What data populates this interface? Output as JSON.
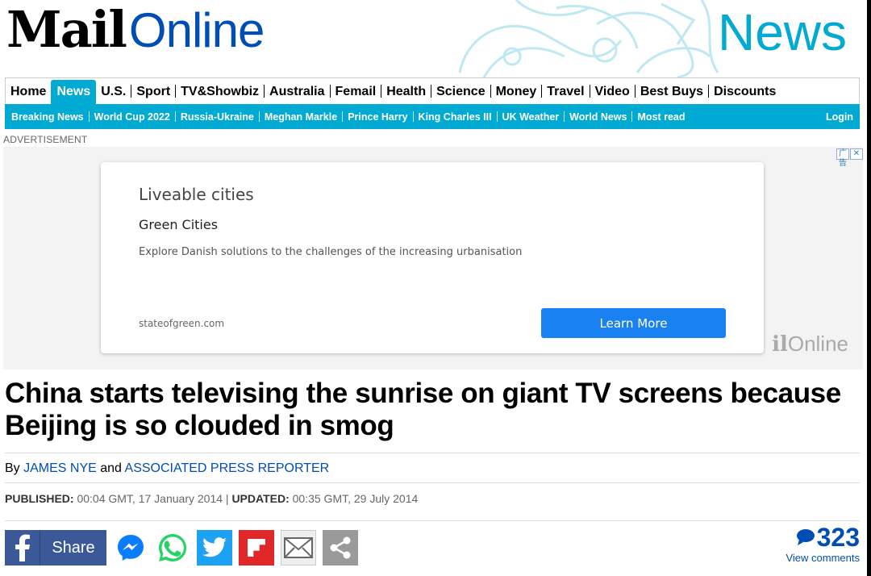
{
  "masthead": {
    "logo_mail": "Mail",
    "logo_online": "Online",
    "section_title": "News"
  },
  "nav_primary": [
    {
      "label": "Home",
      "active": false
    },
    {
      "label": "News",
      "active": true
    },
    {
      "label": "U.S.",
      "active": false
    },
    {
      "label": "Sport",
      "active": false
    },
    {
      "label": "TV&Showbiz",
      "active": false
    },
    {
      "label": "Australia",
      "active": false
    },
    {
      "label": "Femail",
      "active": false
    },
    {
      "label": "Health",
      "active": false
    },
    {
      "label": "Science",
      "active": false
    },
    {
      "label": "Money",
      "active": false
    },
    {
      "label": "Travel",
      "active": false
    },
    {
      "label": "Video",
      "active": false
    },
    {
      "label": "Best Buys",
      "active": false
    },
    {
      "label": "Discounts",
      "active": false
    }
  ],
  "nav_secondary": [
    "Breaking News",
    "World Cup 2022",
    "Russia-Ukraine",
    "Meghan Markle",
    "Prince Harry",
    "King Charles III",
    "UK Weather",
    "World News",
    "Most read"
  ],
  "login_label": "Login",
  "advertisement_label": "ADVERTISEMENT",
  "ad": {
    "choices_icon": "广告",
    "close_icon": "✕",
    "headline": "Liveable cities",
    "advertiser": "Green Cities",
    "body": "Explore Danish solutions to the challenges of the increasing urbanisation",
    "domain": "stateofgreen.com",
    "cta": "Learn More",
    "watermark_mail": "il",
    "watermark_online": "Online"
  },
  "article": {
    "headline": "China starts televising the sunrise on giant TV screens because Beijing is so clouded in smog",
    "byline_prefix": "By ",
    "author1": "JAMES NYE",
    "byline_and": " and ",
    "author2": "ASSOCIATED PRESS REPORTER",
    "published_label": "PUBLISHED:",
    "published_value": " 00:04 GMT, 17 January 2014 | ",
    "updated_label": "UPDATED:",
    "updated_value": " 00:35 GMT, 29 July 2014"
  },
  "share": {
    "facebook_label": "Share",
    "buttons": [
      "facebook-icon",
      "messenger-icon",
      "whatsapp-icon",
      "twitter-icon",
      "flipboard-icon",
      "email-icon",
      "share-more-icon"
    ]
  },
  "comments": {
    "count": "323",
    "view_label": "View comments"
  },
  "colors": {
    "accent": "#00aad2",
    "link": "#004db3",
    "facebook": "#3b5998",
    "twitter": "#1da1f2",
    "flipboard": "#e12828",
    "ad_cta": "#1a82f0"
  }
}
